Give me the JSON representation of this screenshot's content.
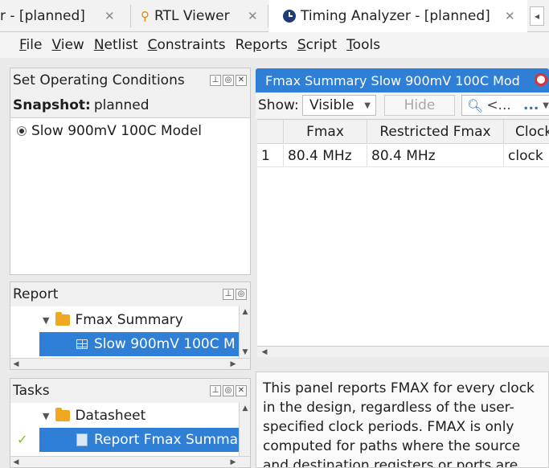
{
  "tabs": [
    {
      "label": "r - [planned]"
    },
    {
      "label": "RTL Viewer"
    },
    {
      "label": "Timing Analyzer - [planned]"
    }
  ],
  "menu": {
    "items": [
      {
        "acc": "F",
        "rest": "ile"
      },
      {
        "acc": "V",
        "rest": "iew"
      },
      {
        "acc": "N",
        "rest": "etlist"
      },
      {
        "acc": "C",
        "rest": "onstraints"
      },
      {
        "pre": "Re",
        "acc": "p",
        "rest": "orts"
      },
      {
        "acc": "S",
        "rest": "cript"
      },
      {
        "acc": "T",
        "rest": "ools"
      }
    ]
  },
  "operating_conditions": {
    "title": "Set Operating Conditions",
    "snapshot_label": "Snapshot:",
    "snapshot_value": "planned",
    "model": "Slow 900mV 100C Model"
  },
  "report_panel": {
    "title": "Report",
    "folder": "Fmax Summary",
    "item": "Slow 900mV 100C M"
  },
  "tasks_panel": {
    "title": "Tasks",
    "folder": "Datasheet",
    "item": "Report Fmax Summa"
  },
  "report_view": {
    "tab_label": "Fmax Summary Slow 900mV 100C Mod",
    "show_label": "Show:",
    "show_value": "Visible",
    "hide_label": "Hide",
    "search_placeholder": "<...",
    "more": "...",
    "columns": [
      "",
      "Fmax",
      "Restricted Fmax",
      "Clock"
    ],
    "rows": [
      [
        "1",
        "80.4 MHz",
        "80.4 MHz",
        "clock"
      ]
    ],
    "description": "This panel reports FMAX for every clock in the design, regardless of the user-specified clock periods. FMAX is only computed for paths where the source and destination registers or ports are"
  }
}
